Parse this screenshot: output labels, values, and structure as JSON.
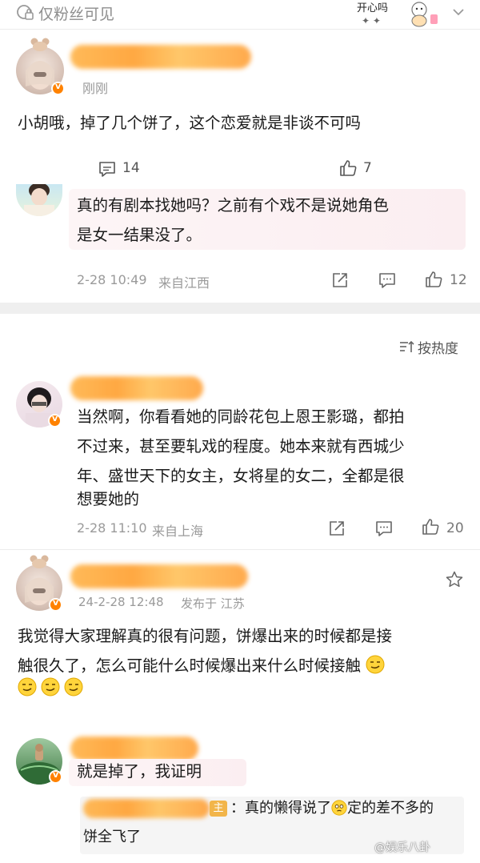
{
  "topbar": {
    "visibility": "仅粉丝可见",
    "sticker_text": "开心吗"
  },
  "post": {
    "time": "刚刚",
    "text": "小胡哦，掉了几个饼了，这个恋爱就是非谈不可吗",
    "comment_count": "14",
    "like_count": "7"
  },
  "reply1": {
    "text_line1": "真的有剧本找她吗？之前有个戏不是说她角色",
    "text_line2": "是女一结果没了。",
    "time": "2-28 10:49",
    "location": "来自江西",
    "like_count": "12"
  },
  "sort": {
    "label": "按热度"
  },
  "comment2": {
    "line1": "当然啊，你看看她的同龄花包上恩王影璐，都拍",
    "line2": "不过来，甚至要轧戏的程度。她本来就有西城少",
    "line3": "年、盛世天下的女主，女将星的女二，全都是很",
    "line4": "想要她的",
    "time": "2-28 11:10",
    "location": "来自上海",
    "like_count": "20"
  },
  "comment3": {
    "time": "24-2-28 12:48",
    "location": "发布于 江苏",
    "line1": "我觉得大家理解真的很有问题，饼爆出来的时候都是接",
    "line2": "触很久了，怎么可能什么时候爆出来什么时候接触"
  },
  "comment4": {
    "text": "就是掉了，我证明",
    "quote_line1": "：真的懒得说了",
    "quote_mid": "定的差不多的",
    "quote_line2": "饼全飞了",
    "quote_tag": "主"
  },
  "watermark": "@娱乐八卦"
}
